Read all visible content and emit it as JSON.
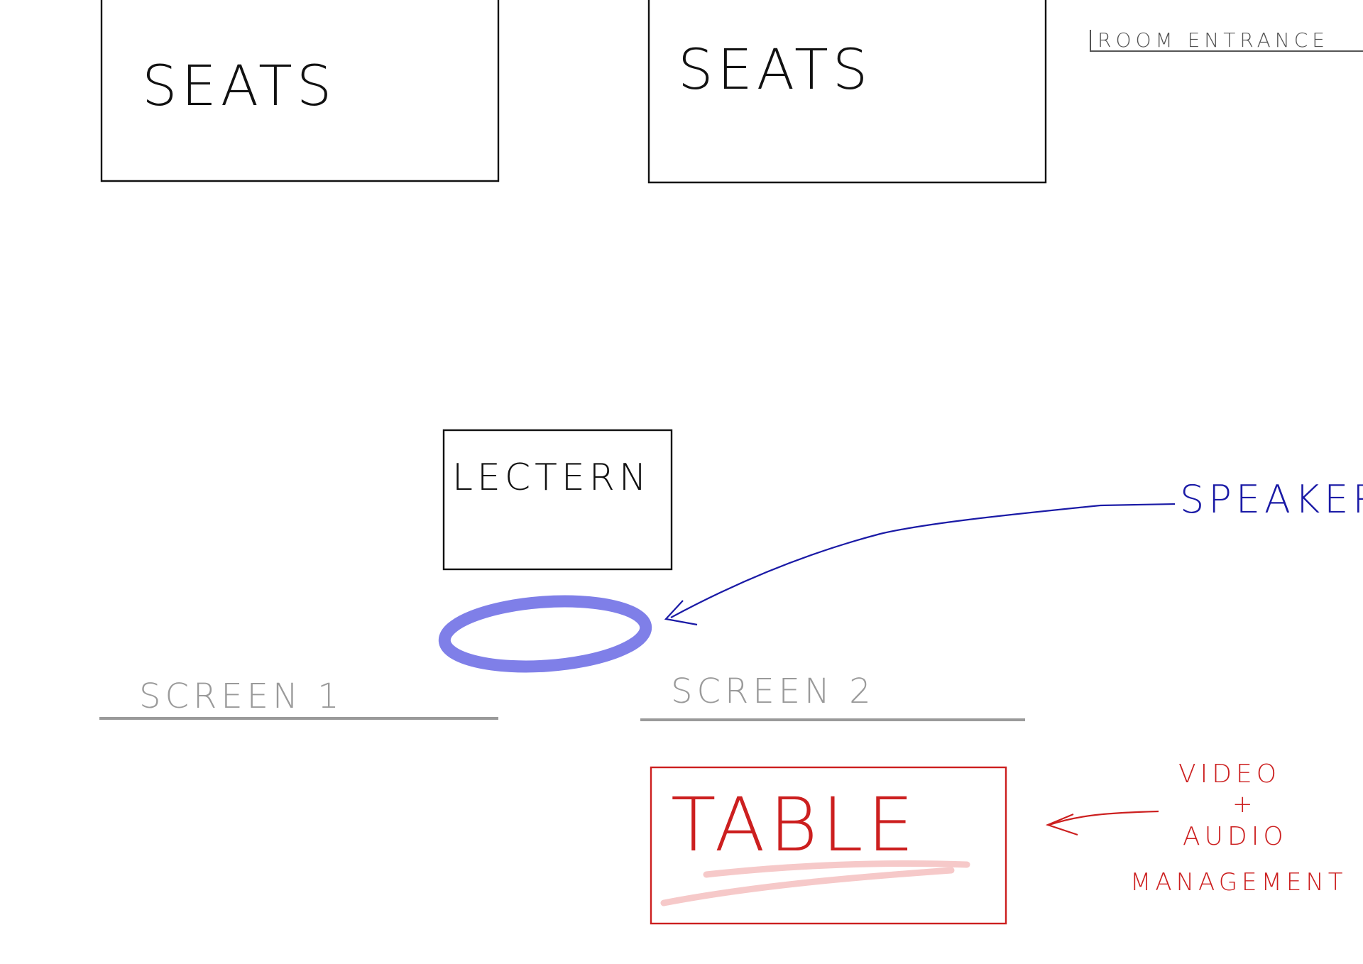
{
  "labels": {
    "seats_left": "SEATS",
    "seats_right": "SEATS",
    "room_entrance": "ROOM ENTRANCE",
    "lectern": "LECTERN",
    "speaker": "SPEAKER",
    "screen_1": "SCREEN 1",
    "screen_2": "SCREEN 2",
    "table": "TABLE",
    "video_line": "VIDEO",
    "plus_line": "+",
    "audio_line": "AUDIO",
    "management_line": "MANAGEMENT"
  },
  "colors": {
    "ink_black": "#111111",
    "ink_gray": "#9a9a9a",
    "entrance_gray": "#555555",
    "speaker_blue": "#1a1aa6",
    "highlight_blue": "#7f7fe8",
    "table_red": "#cc1f1f",
    "highlight_pink": "#f6c9c9"
  }
}
